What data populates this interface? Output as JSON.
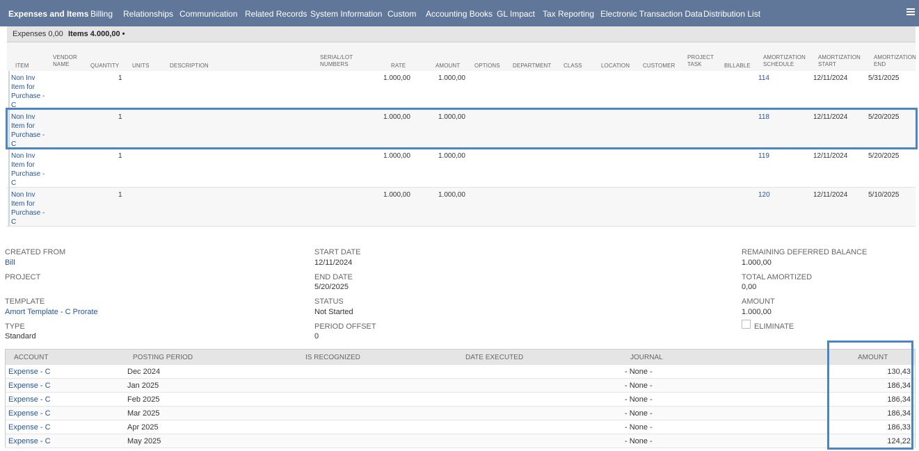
{
  "tabs": [
    {
      "label": "Expenses and Items",
      "active": true
    },
    {
      "label": "Billing"
    },
    {
      "label": "Relationships"
    },
    {
      "label": "Communication"
    },
    {
      "label": "Related Records"
    },
    {
      "label": "System Information"
    },
    {
      "label": "Custom"
    },
    {
      "label": "Accounting Books"
    },
    {
      "label": "GL Impact"
    },
    {
      "label": "Tax Reporting"
    },
    {
      "label": "Electronic Transaction Data"
    },
    {
      "label": "Distribution List"
    }
  ],
  "subtabs": {
    "expenses": "Expenses 0,00",
    "items": "Items 4.000,00 •"
  },
  "items_table": {
    "headers": {
      "item": "ITEM",
      "vendor_name": "VENDOR NAME",
      "quantity": "QUANTITY",
      "units": "UNITS",
      "description": "DESCRIPTION",
      "serial": "SERIAL/LOT NUMBERS",
      "rate": "RATE",
      "amount": "AMOUNT",
      "options": "OPTIONS",
      "department": "DEPARTMENT",
      "class": "CLASS",
      "location": "LOCATION",
      "customer": "CUSTOMER",
      "project_task": "PROJECT TASK",
      "billable": "BILLABLE",
      "amort_schedule": "AMORTIZATION SCHEDULE",
      "amort_start": "AMORTIZATION START",
      "amort_end": "AMORTIZATION END"
    },
    "rows": [
      {
        "item": "Non Inv Item for Purchase - C",
        "quantity": "1",
        "rate": "1.000,00",
        "amount": "1.000,00",
        "schedule": "114",
        "start": "12/11/2024",
        "end": "5/31/2025"
      },
      {
        "item": "Non Inv Item for Purchase - C",
        "quantity": "1",
        "rate": "1.000,00",
        "amount": "1.000,00",
        "schedule": "118",
        "start": "12/11/2024",
        "end": "5/20/2025"
      },
      {
        "item": "Non Inv Item for Purchase - C",
        "quantity": "1",
        "rate": "1.000,00",
        "amount": "1.000,00",
        "schedule": "119",
        "start": "12/11/2024",
        "end": "5/20/2025"
      },
      {
        "item": "Non Inv Item for Purchase - C",
        "quantity": "1",
        "rate": "1.000,00",
        "amount": "1.000,00",
        "schedule": "120",
        "start": "12/11/2024",
        "end": "5/10/2025"
      }
    ]
  },
  "summary": {
    "created_from": {
      "label": "CREATED FROM",
      "value": "Bill"
    },
    "project": {
      "label": "PROJECT",
      "value": ""
    },
    "template": {
      "label": "TEMPLATE",
      "value": "Amort Template - C Prorate"
    },
    "type": {
      "label": "TYPE",
      "value": "Standard"
    },
    "start_date": {
      "label": "START DATE",
      "value": "12/11/2024"
    },
    "end_date": {
      "label": "END DATE",
      "value": "5/20/2025"
    },
    "status": {
      "label": "STATUS",
      "value": "Not Started"
    },
    "period_offset": {
      "label": "PERIOD OFFSET",
      "value": "0"
    },
    "remaining": {
      "label": "REMAINING DEFERRED BALANCE",
      "value": "1.000,00"
    },
    "total_amortized": {
      "label": "TOTAL AMORTIZED",
      "value": "0,00"
    },
    "amount": {
      "label": "AMOUNT",
      "value": "1.000,00"
    },
    "eliminate": {
      "label": "ELIMINATE",
      "checked": false
    }
  },
  "schedule_table": {
    "headers": {
      "account": "ACCOUNT",
      "posting_period": "POSTING PERIOD",
      "is_recognized": "IS RECOGNIZED",
      "date_executed": "DATE EXECUTED",
      "journal": "JOURNAL",
      "amount": "AMOUNT"
    },
    "rows": [
      {
        "account": "Expense - C",
        "period": "Dec 2024",
        "journal": "- None -",
        "amount": "130,43"
      },
      {
        "account": "Expense - C",
        "period": "Jan 2025",
        "journal": "- None -",
        "amount": "186,34"
      },
      {
        "account": "Expense - C",
        "period": "Feb 2025",
        "journal": "- None -",
        "amount": "186,34"
      },
      {
        "account": "Expense - C",
        "period": "Mar 2025",
        "journal": "- None -",
        "amount": "186,34"
      },
      {
        "account": "Expense - C",
        "period": "Apr 2025",
        "journal": "- None -",
        "amount": "186,33"
      },
      {
        "account": "Expense - C",
        "period": "May 2025",
        "journal": "- None -",
        "amount": "124,22"
      }
    ]
  },
  "colors": {
    "tabbar": "#607799",
    "link": "#255599",
    "highlight": "#4a86c5"
  }
}
